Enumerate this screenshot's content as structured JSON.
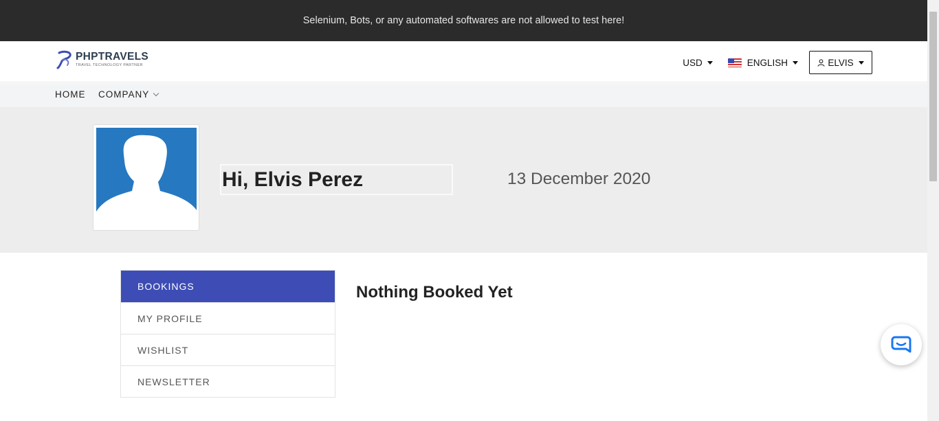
{
  "notice": "Selenium, Bots, or any automated softwares are not allowed to test here!",
  "logo": {
    "title": "PHPTRAVELS",
    "subtitle": "TRAVEL TECHNOLOGY PARTNER",
    "brand_color": "#3d4db5"
  },
  "header": {
    "currency": "USD",
    "language": "ENGLISH",
    "user": "ELVIS",
    "icons": [
      "flag-us-icon",
      "user-icon",
      "caret-down-icon"
    ]
  },
  "nav": {
    "home": "HOME",
    "company": "COMPANY"
  },
  "profile": {
    "greeting": "Hi, Elvis Perez",
    "date": "13 December 2020",
    "avatar_color": "#2678c1"
  },
  "sidebar": {
    "items": [
      {
        "label": "BOOKINGS",
        "active": true
      },
      {
        "label": "MY PROFILE",
        "active": false
      },
      {
        "label": "WISHLIST",
        "active": false
      },
      {
        "label": "NEWSLETTER",
        "active": false
      }
    ],
    "active_color": "#3d4db5"
  },
  "main": {
    "empty_message": "Nothing Booked Yet"
  },
  "chat": {
    "icon": "chat-icon",
    "color": "#1877f2"
  }
}
